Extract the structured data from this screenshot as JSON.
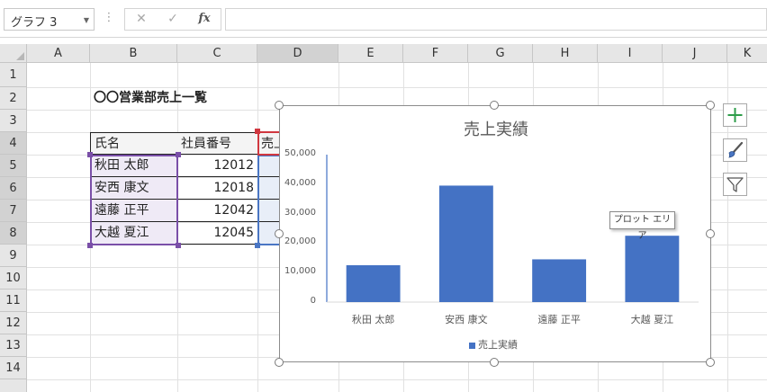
{
  "formula_bar": {
    "name_box": "グラフ 3",
    "cancel_icon": "✕",
    "enter_icon": "✓",
    "fx_label": "fx",
    "formula": ""
  },
  "columns": [
    "A",
    "B",
    "C",
    "D",
    "E",
    "F",
    "G",
    "H",
    "I",
    "J",
    "K"
  ],
  "rows": [
    "1",
    "2",
    "3",
    "4",
    "5",
    "6",
    "7",
    "8",
    "9",
    "10",
    "11",
    "12",
    "13",
    "14"
  ],
  "sheet": {
    "title": "〇〇営業部売上一覧",
    "table": {
      "headers": [
        "氏名",
        "社員番号",
        "売上"
      ],
      "rows": [
        {
          "name": "秋田 太郎",
          "id": "12012"
        },
        {
          "name": "安西 康文",
          "id": "12018"
        },
        {
          "name": "遠藤 正平",
          "id": "12042"
        },
        {
          "name": "大越 夏江",
          "id": "12045"
        }
      ]
    }
  },
  "chart_data": {
    "type": "bar",
    "title": "売上実績",
    "categories": [
      "秋田 太郎",
      "安西 康文",
      "遠藤 正平",
      "大越 夏江"
    ],
    "series": [
      {
        "name": "売上実績",
        "values": [
          12500,
          39500,
          14500,
          22500
        ]
      }
    ],
    "ylim": [
      0,
      50000
    ],
    "yticks": [
      "0",
      "10,000",
      "20,000",
      "30,000",
      "40,000",
      "50,000"
    ],
    "ytick_values": [
      0,
      10000,
      20000,
      30000,
      40000,
      50000
    ],
    "grid": false,
    "legend": "bottom",
    "bar_color": "#4472c4"
  },
  "tooltip": "プロット エリア",
  "chart_buttons": {
    "elements": "chart-elements-plus-icon",
    "styles": "chart-styles-brush-icon",
    "filters": "chart-filters-funnel-icon"
  },
  "colors": {
    "selection_purple": "#7a4fa8",
    "selection_blue": "#4a76c4",
    "selection_red": "#d0373f",
    "plus_green": "#2e9d4a"
  }
}
